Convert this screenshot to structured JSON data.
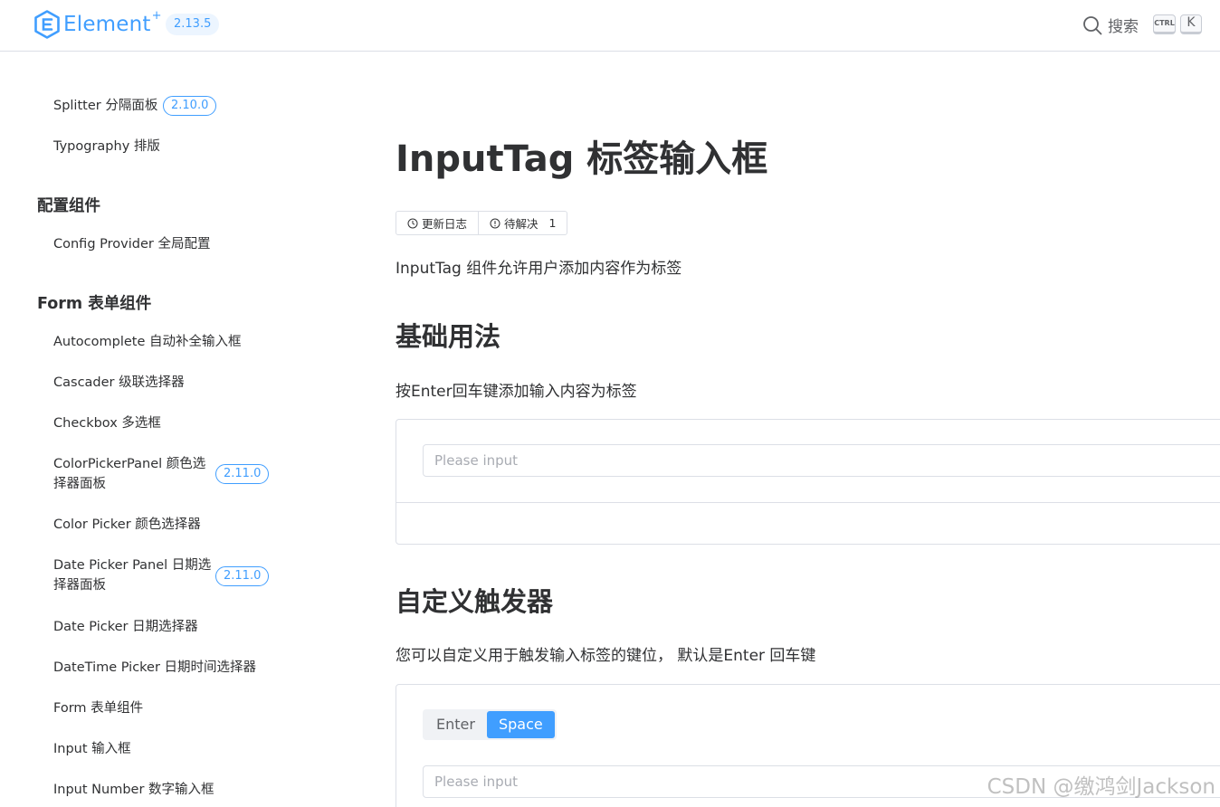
{
  "header": {
    "logo_text": "Element",
    "logo_sup": "+",
    "version": "2.13.5",
    "search_label": "搜索",
    "kbd_ctrl": "CTRL",
    "kbd_k": "K",
    "accent_color": "#409eff"
  },
  "sidebar": {
    "items": [
      {
        "label": "Splitter 分隔面板",
        "badge": "2.10.0"
      },
      {
        "label": "Typography 排版"
      },
      {
        "label": "配置组件",
        "group": true
      },
      {
        "label": "Config Provider 全局配置"
      },
      {
        "label": "Form 表单组件",
        "group": true
      },
      {
        "label": "Autocomplete 自动补全输入框"
      },
      {
        "label": "Cascader 级联选择器"
      },
      {
        "label": "Checkbox 多选框"
      },
      {
        "label": "ColorPickerPanel 颜色选择器面板",
        "badge": "2.11.0"
      },
      {
        "label": "Color Picker 颜色选择器"
      },
      {
        "label": "Date Picker Panel 日期选择器面板",
        "badge": "2.11.0"
      },
      {
        "label": "Date Picker 日期选择器"
      },
      {
        "label": "DateTime Picker 日期时间选择器"
      },
      {
        "label": "Form 表单组件"
      },
      {
        "label": "Input 输入框"
      },
      {
        "label": "Input Number 数字输入框"
      }
    ]
  },
  "main": {
    "title": "InputTag 标签输入框",
    "changelog_label": "更新日志",
    "pending_label": "待解决",
    "pending_count": "1",
    "intro": "InputTag 组件允许用户添加内容作为标签",
    "basic": {
      "heading": "基础用法",
      "desc": "按Enter回车键添加输入内容为标签",
      "placeholder": "Please input"
    },
    "trigger": {
      "heading": "自定义触发器",
      "desc": "您可以自定义用于触发输入标签的键位， 默认是Enter 回车键",
      "options": [
        "Enter",
        "Space"
      ],
      "selected": "Space",
      "placeholder": "Please input"
    }
  },
  "watermark": "CSDN @缴鸿剑Jackson"
}
